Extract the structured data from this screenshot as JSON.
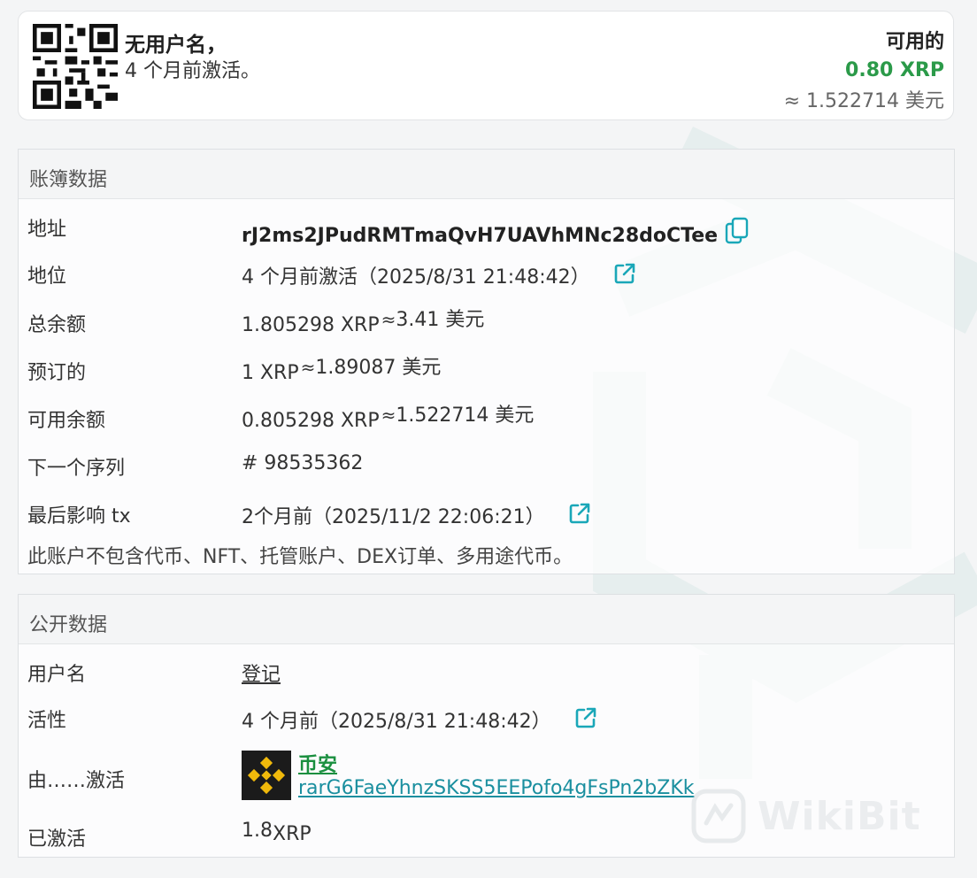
{
  "summary": {
    "name": "无用户名，",
    "sub": "4 个月前激活。",
    "available_label": "可用的",
    "available_value": "0.80 XRP",
    "available_usd": "≈ 1.522714 美元"
  },
  "ledger": {
    "header": "账簿数据",
    "rows": [
      {
        "label": "地址",
        "value": "rJ2ms2JPudRMTmaQvH7UAVhMNc28doCTee"
      },
      {
        "label": "地位",
        "value": "4 个月前激活",
        "time": "（2025/8/31 21:48:42）"
      },
      {
        "label": "总余额",
        "value": "1.805298 XRP",
        "approx": "≈",
        "usd": " 3.41 美元"
      },
      {
        "label": "预订的",
        "value": "1 XRP",
        "approx": "≈",
        "usd": " 1.89087 美元"
      },
      {
        "label": "可用余额",
        "value": "0.805298 XRP",
        "approx": "≈",
        "usd": " 1.522714 美元"
      },
      {
        "label": "下一个序列",
        "value": "# 98535362"
      },
      {
        "label": "最后影响 tx",
        "value": "2个月前",
        "time": "（2025/11/2 22:06:21）"
      }
    ],
    "note": "此账户不包含代币、NFT、托管账户、DEX订单、多用途代币。"
  },
  "public": {
    "header": "公开数据",
    "rows": [
      {
        "label": "用户名",
        "value": "登记"
      },
      {
        "label": "活性",
        "value": "4 个月前",
        "time": "（2025/8/31 21:48:42）"
      },
      {
        "label": "由……激活",
        "name": "币安",
        "address": "rarG6FaeYhnzSKSS5EEPofo4gFsPn2bZKk"
      },
      {
        "label": "已激活",
        "value_num": "1.8",
        "value_unit": " XRP"
      }
    ]
  },
  "watermark": "WikiBit",
  "colors": {
    "green": "#2b9a49",
    "teal": "#1a8f9f",
    "binance_yellow": "#f0b90b"
  }
}
